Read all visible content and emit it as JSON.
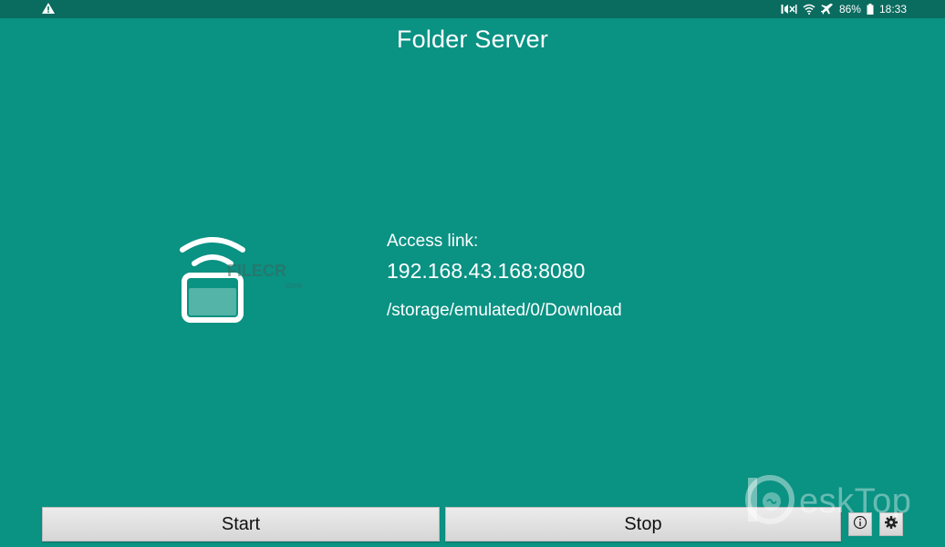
{
  "status_bar": {
    "warning_icon": "warning-triangle-icon",
    "icons": [
      "mute-icon",
      "wifi-icon",
      "airplane-icon"
    ],
    "battery": "86%",
    "time": "18:33"
  },
  "app": {
    "title": "Folder Server",
    "icon": "folder-wifi-icon"
  },
  "info": {
    "access_label": "Access link:",
    "access_link": "192.168.43.168:8080",
    "storage_path": "/storage/emulated/0/Download"
  },
  "buttons": {
    "start_label": "Start",
    "stop_label": "Stop",
    "info_icon": "info-icon",
    "settings_icon": "gear-icon"
  },
  "watermarks": {
    "filecr": "FILECR",
    "filecr_com": ".com",
    "desktop": "eskTop"
  },
  "colors": {
    "background": "#0a9283",
    "status_bar": "#0a6b5f",
    "button": "#e0e0e0"
  }
}
